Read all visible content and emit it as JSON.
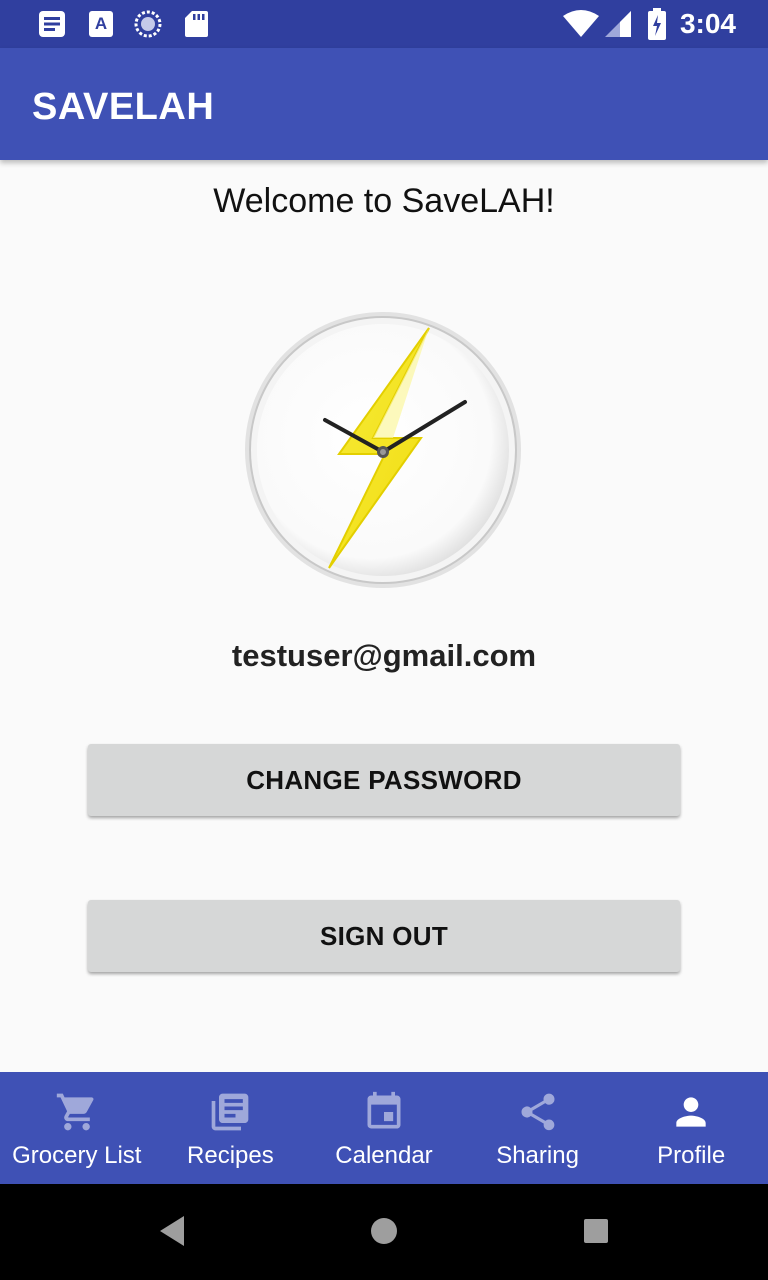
{
  "status_bar": {
    "time": "3:04",
    "icons": [
      "notes-icon",
      "text-icon",
      "sync-icon",
      "sd-card-icon",
      "wifi-icon",
      "signal-icon",
      "battery-icon"
    ]
  },
  "app_bar": {
    "title": "SAVELAH"
  },
  "profile": {
    "welcome": "Welcome to SaveLAH!",
    "email": "testuser@gmail.com",
    "change_password_label": "CHANGE PASSWORD",
    "sign_out_label": "SIGN OUT"
  },
  "bottom_nav": {
    "items": [
      {
        "label": "Grocery List",
        "icon": "cart-icon"
      },
      {
        "label": "Recipes",
        "icon": "recipes-icon"
      },
      {
        "label": "Calendar",
        "icon": "calendar-icon"
      },
      {
        "label": "Sharing",
        "icon": "share-icon"
      },
      {
        "label": "Profile",
        "icon": "person-icon"
      }
    ],
    "active_index": 4
  },
  "colors": {
    "primary": "#3f51b5",
    "primary_dark": "#303f9f",
    "button_bg": "#d6d7d7",
    "inactive_icon": "#9fa8da"
  }
}
